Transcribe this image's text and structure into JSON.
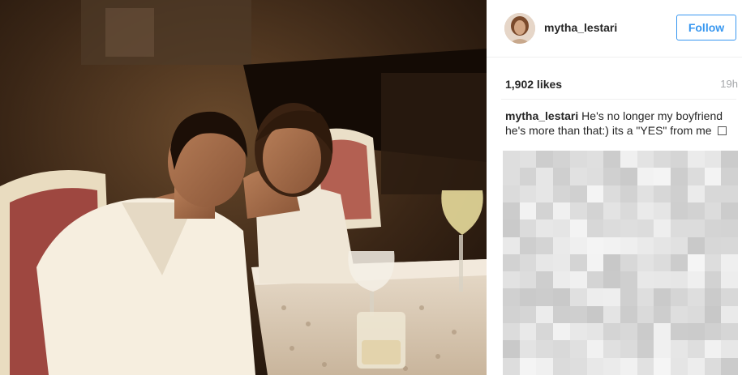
{
  "post": {
    "username": "mytha_lestari",
    "follow_label": "Follow",
    "likes": "1,902 likes",
    "timestamp": "19h",
    "caption_user": "mytha_lestari",
    "caption_text": "He's no longer my boyfriend he's more than that:) its a \"YES\" from me"
  },
  "icons": {
    "avatar": "profile-avatar",
    "emoji": "emoji-icon"
  },
  "colors": {
    "follow_blue": "#3897f0",
    "text": "#262626",
    "muted": "#a5a7aa",
    "border": "#efefef"
  }
}
